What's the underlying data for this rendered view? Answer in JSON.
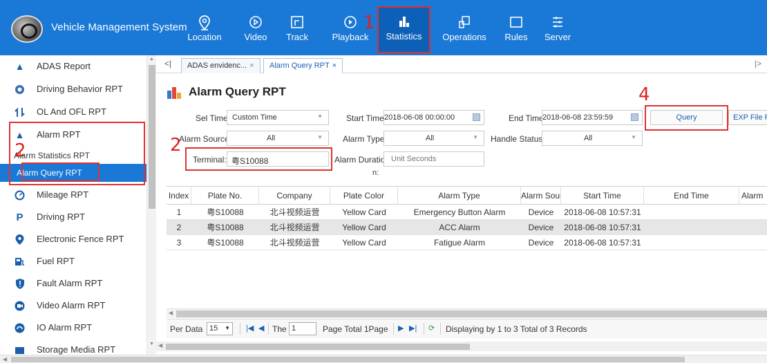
{
  "header": {
    "app_title": "Vehicle Management System",
    "nav": [
      {
        "label": "Location",
        "icon": "location-pin-icon"
      },
      {
        "label": "Video",
        "icon": "play-circle-icon"
      },
      {
        "label": "Track",
        "icon": "track-icon"
      },
      {
        "label": "Playback",
        "icon": "playback-icon"
      },
      {
        "label": "Statistics",
        "icon": "bar-chart-icon"
      },
      {
        "label": "Operations",
        "icon": "operations-icon"
      },
      {
        "label": "Rules",
        "icon": "rules-icon"
      },
      {
        "label": "Server",
        "icon": "server-icon"
      }
    ],
    "active_nav": "Statistics"
  },
  "annotations": {
    "step1": "1",
    "step2a": "2",
    "step2b": "2",
    "step4": "4"
  },
  "sidebar": {
    "items": [
      {
        "label": "ADAS Report",
        "icon": "warning-triangle-icon"
      },
      {
        "label": "Driving Behavior RPT",
        "icon": "steering-wheel-icon"
      },
      {
        "label": "OL And OFL RPT",
        "icon": "online-offline-icon"
      },
      {
        "label": "Alarm RPT",
        "icon": "warning-triangle-icon"
      },
      {
        "label": "Mileage RPT",
        "icon": "speedometer-icon"
      },
      {
        "label": "Driving RPT",
        "icon": "parking-icon"
      },
      {
        "label": "Electronic Fence RPT",
        "icon": "location-pin-icon"
      },
      {
        "label": "Fuel RPT",
        "icon": "fuel-icon"
      },
      {
        "label": "Fault Alarm RPT",
        "icon": "shield-icon"
      },
      {
        "label": "Video Alarm RPT",
        "icon": "video-camera-icon"
      },
      {
        "label": "IO Alarm RPT",
        "icon": "io-icon"
      },
      {
        "label": "Storage Media RPT",
        "icon": "storage-icon"
      }
    ],
    "sub_items": [
      {
        "label": "Alarm Statistics RPT"
      },
      {
        "label": "Alarm Query RPT"
      }
    ],
    "active": "Alarm Query RPT"
  },
  "tabs": [
    {
      "label": "ADAS envidenc..."
    },
    {
      "label": "Alarm Query RPT"
    }
  ],
  "tab_close": "×",
  "page": {
    "title": "Alarm Query RPT"
  },
  "filters": {
    "sel_time_label": "Sel Time:",
    "sel_time_value": "Custom Time",
    "start_time_label": "Start Time:",
    "start_time_value": "2018-06-08 00:00:00",
    "end_time_label": "End Time:",
    "end_time_value": "2018-06-08 23:59:59",
    "query_button": "Query",
    "export_button": "EXP File F",
    "alarm_source_label": "Alarm Source",
    "alarm_source_value": "All",
    "alarm_type_label": "Alarm Type:",
    "alarm_type_value": "All",
    "handle_status_label": "Handle Status:",
    "handle_status_value": "All",
    "terminal_label": "Terminal:",
    "terminal_value": "粤S10088",
    "alarm_duration_label_1": "Alarm Duratio",
    "alarm_duration_label_2": "n:",
    "alarm_duration_placeholder": "Unit Seconds"
  },
  "table": {
    "columns": [
      "Index",
      "Plate No.",
      "Company",
      "Plate Color",
      "Alarm Type",
      "Alarm Sour",
      "Start Time",
      "End Time",
      "Alarm"
    ],
    "rows": [
      [
        "1",
        "粤S10088",
        "北斗视频运营",
        "Yellow Card",
        "Emergency Button Alarm",
        "Device",
        "2018-06-08 10:57:31",
        "",
        ""
      ],
      [
        "2",
        "粤S10088",
        "北斗视频运营",
        "Yellow Card",
        "ACC Alarm",
        "Device",
        "2018-06-08 10:57:31",
        "",
        ""
      ],
      [
        "3",
        "粤S10088",
        "北斗视频运营",
        "Yellow Card",
        "Fatigue Alarm",
        "Device",
        "2018-06-08 10:57:31",
        "",
        ""
      ]
    ]
  },
  "pager": {
    "per_data_label": "Per Data",
    "per_data_value": "15",
    "the_label": "The",
    "page_value": "1",
    "page_total": "Page  Total 1Page",
    "summary": "Displaying by 1 to 3 Total of 3 Records"
  },
  "colors": {
    "header_bg": "#1a78d6",
    "active_bg": "#1a78d6",
    "annotation_red": "#e02020"
  }
}
